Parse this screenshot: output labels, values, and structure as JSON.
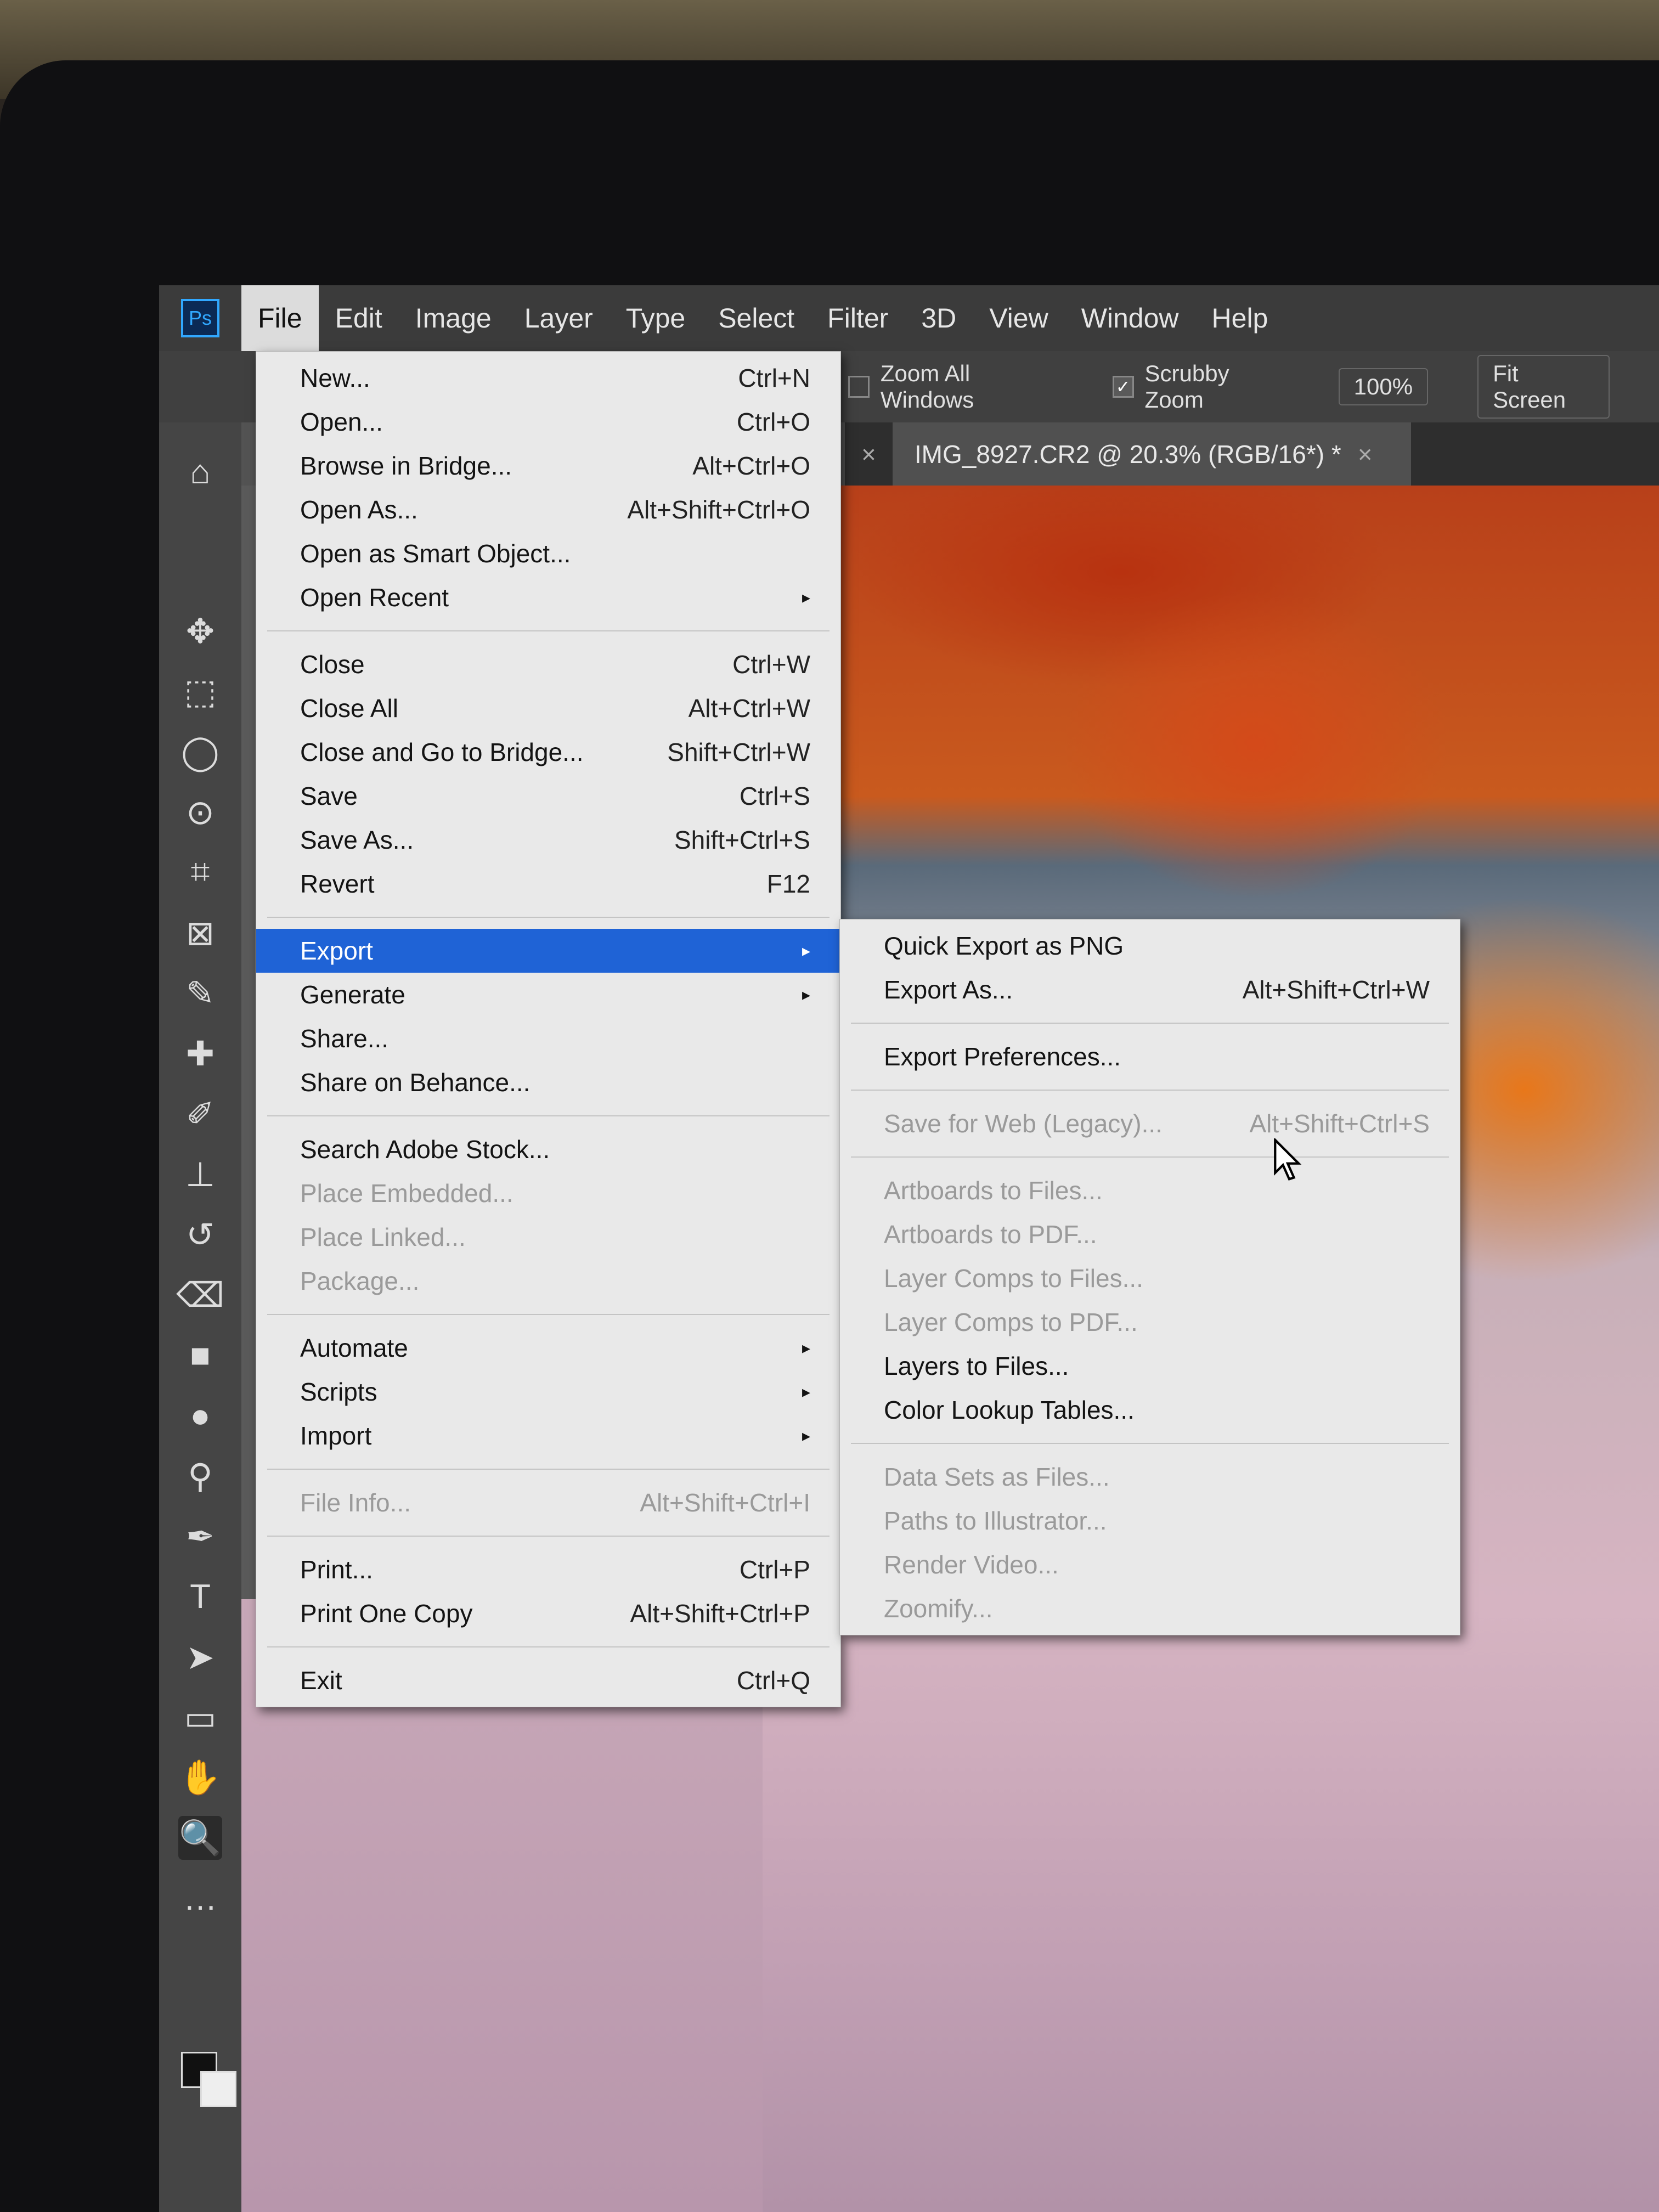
{
  "menubar": {
    "items": [
      "File",
      "Edit",
      "Image",
      "Layer",
      "Type",
      "Select",
      "Filter",
      "3D",
      "View",
      "Window",
      "Help"
    ]
  },
  "options": {
    "zoom_all_windows": "Zoom All Windows",
    "scrubby_zoom": "Scrubby Zoom",
    "zoom_pct": "100%",
    "fit_screen": "Fit Screen"
  },
  "document": {
    "tab_title": "IMG_8927.CR2 @ 20.3% (RGB/16*) *",
    "close": "×"
  },
  "file_menu": {
    "groups": [
      [
        {
          "label": "New...",
          "shortcut": "Ctrl+N"
        },
        {
          "label": "Open...",
          "shortcut": "Ctrl+O"
        },
        {
          "label": "Browse in Bridge...",
          "shortcut": "Alt+Ctrl+O"
        },
        {
          "label": "Open As...",
          "shortcut": "Alt+Shift+Ctrl+O"
        },
        {
          "label": "Open as Smart Object...",
          "shortcut": ""
        },
        {
          "label": "Open Recent",
          "shortcut": "▸"
        }
      ],
      [
        {
          "label": "Close",
          "shortcut": "Ctrl+W"
        },
        {
          "label": "Close All",
          "shortcut": "Alt+Ctrl+W"
        },
        {
          "label": "Close and Go to Bridge...",
          "shortcut": "Shift+Ctrl+W"
        },
        {
          "label": "Save",
          "shortcut": "Ctrl+S"
        },
        {
          "label": "Save As...",
          "shortcut": "Shift+Ctrl+S"
        },
        {
          "label": "Revert",
          "shortcut": "F12"
        }
      ],
      [
        {
          "label": "Export",
          "shortcut": "▸"
        },
        {
          "label": "Generate",
          "shortcut": "▸"
        },
        {
          "label": "Share...",
          "shortcut": ""
        },
        {
          "label": "Share on Behance...",
          "shortcut": ""
        }
      ],
      [
        {
          "label": "Search Adobe Stock...",
          "shortcut": ""
        },
        {
          "label": "Place Embedded...",
          "shortcut": ""
        },
        {
          "label": "Place Linked...",
          "shortcut": ""
        },
        {
          "label": "Package...",
          "shortcut": ""
        }
      ],
      [
        {
          "label": "Automate",
          "shortcut": "▸"
        },
        {
          "label": "Scripts",
          "shortcut": "▸"
        },
        {
          "label": "Import",
          "shortcut": "▸"
        }
      ],
      [
        {
          "label": "File Info...",
          "shortcut": "Alt+Shift+Ctrl+I"
        }
      ],
      [
        {
          "label": "Print...",
          "shortcut": "Ctrl+P"
        },
        {
          "label": "Print One Copy",
          "shortcut": "Alt+Shift+Ctrl+P"
        }
      ],
      [
        {
          "label": "Exit",
          "shortcut": "Ctrl+Q"
        }
      ]
    ]
  },
  "export_menu": {
    "groups": [
      [
        {
          "label": "Quick Export as PNG",
          "shortcut": ""
        },
        {
          "label": "Export As...",
          "shortcut": "Alt+Shift+Ctrl+W"
        }
      ],
      [
        {
          "label": "Export Preferences...",
          "shortcut": ""
        }
      ],
      [
        {
          "label": "Save for Web (Legacy)...",
          "shortcut": "Alt+Shift+Ctrl+S"
        }
      ],
      [
        {
          "label": "Artboards to Files...",
          "shortcut": ""
        },
        {
          "label": "Artboards to PDF...",
          "shortcut": ""
        },
        {
          "label": "Layer Comps to Files...",
          "shortcut": ""
        },
        {
          "label": "Layer Comps to PDF...",
          "shortcut": ""
        },
        {
          "label": "Layers to Files...",
          "shortcut": ""
        },
        {
          "label": "Color Lookup Tables...",
          "shortcut": ""
        }
      ],
      [
        {
          "label": "Data Sets as Files...",
          "shortcut": ""
        },
        {
          "label": "Paths to Illustrator...",
          "shortcut": ""
        },
        {
          "label": "Render Video...",
          "shortcut": ""
        },
        {
          "label": "Zoomify...",
          "shortcut": ""
        }
      ]
    ]
  },
  "toolbar": {
    "tools": [
      "home-icon",
      "move-icon",
      "marquee-icon",
      "lasso-icon",
      "quick-select-icon",
      "crop-icon",
      "frame-icon",
      "eyedropper-icon",
      "healing-icon",
      "brush-icon",
      "stamp-icon",
      "history-brush-icon",
      "eraser-icon",
      "gradient-icon",
      "blur-icon",
      "dodge-icon",
      "pen-icon",
      "type-icon",
      "path-select-icon",
      "rectangle-icon",
      "hand-icon",
      "zoom-icon",
      "more-icon"
    ],
    "glyphs": [
      "⌂",
      "✥",
      "⬚",
      "◯",
      "⊙",
      "⌗",
      "⊠",
      "✎",
      "✚",
      "✐",
      "⊥",
      "↺",
      "⌫",
      "■",
      "●",
      "⚲",
      "✒",
      "T",
      "➤",
      "▭",
      "✋",
      "🔍",
      "…"
    ]
  }
}
